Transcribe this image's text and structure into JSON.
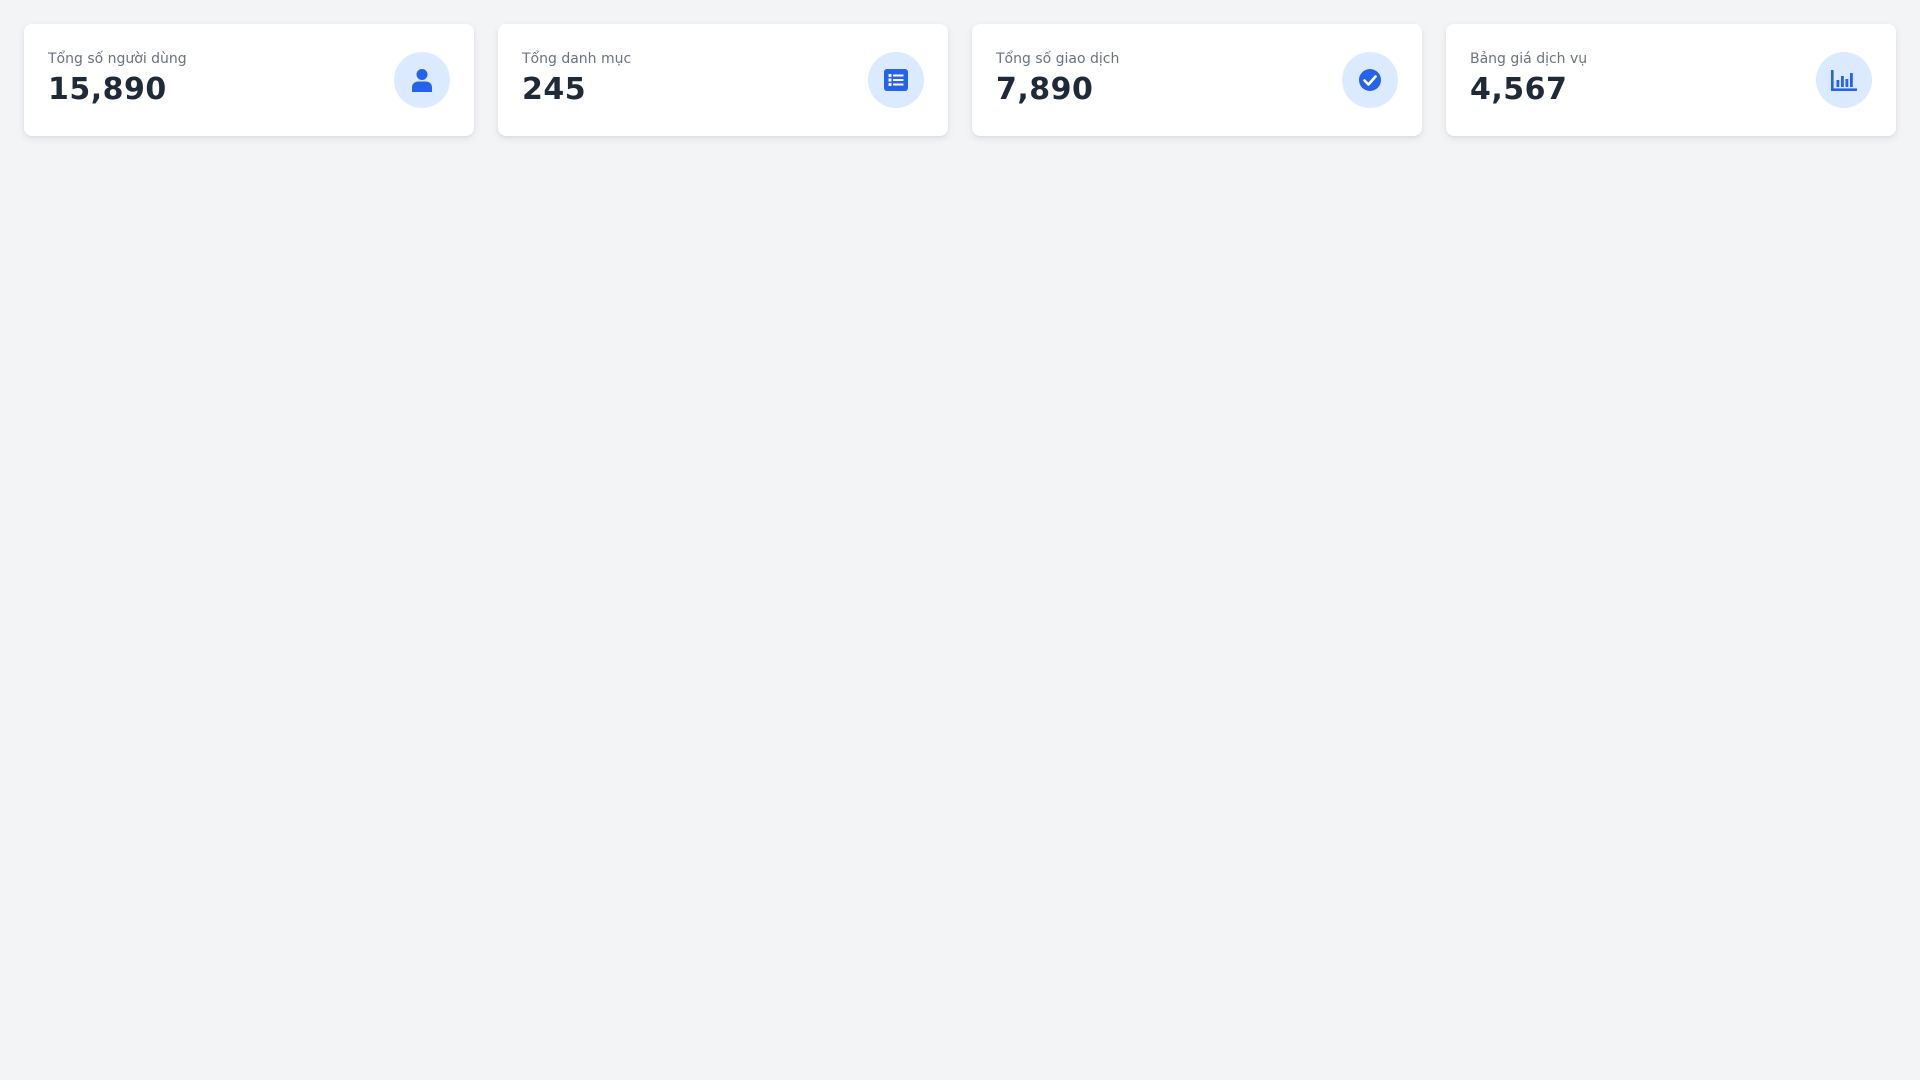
{
  "colors": {
    "page_background": "#f3f4f6",
    "card_background": "#ffffff",
    "label_text": "#6b7280",
    "value_text": "#1f2937",
    "icon_accent": "#2563eb",
    "icon_badge_background": "#dbeafe"
  },
  "stats": [
    {
      "label": "Tổng số người dùng",
      "value": "15,890",
      "icon": "user-icon"
    },
    {
      "label": "Tổng danh mục",
      "value": "245",
      "icon": "list-icon"
    },
    {
      "label": "Tổng số giao dịch",
      "value": "7,890",
      "icon": "check-circle-icon"
    },
    {
      "label": "Bảng giá dịch vụ",
      "value": "4,567",
      "icon": "bar-chart-icon"
    }
  ]
}
